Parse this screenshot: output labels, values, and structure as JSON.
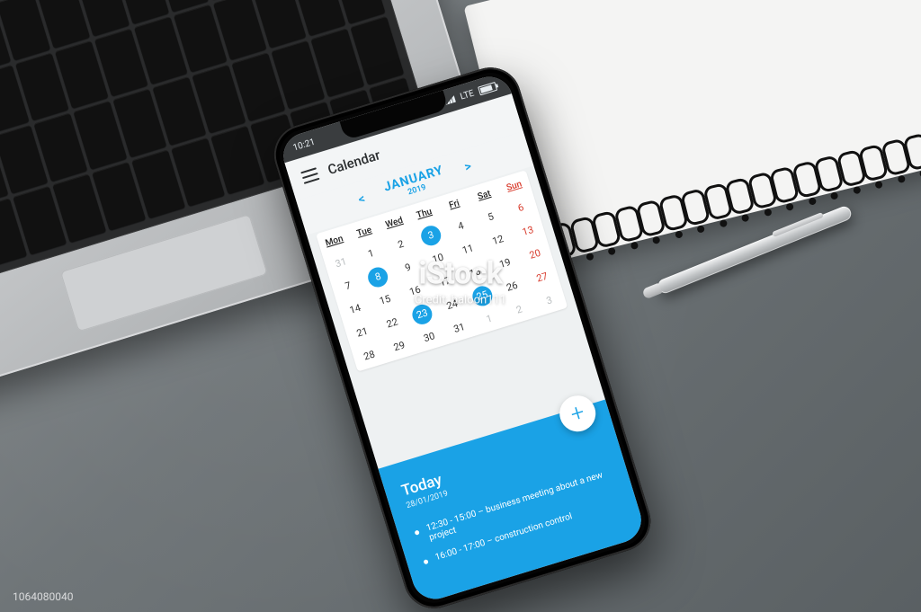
{
  "phone": {
    "status": {
      "time": "10:21",
      "network": "LTE"
    },
    "app": {
      "title": "Calendar",
      "nav": {
        "prev": "<",
        "next": ">",
        "month": "JANUARY",
        "year": "2019"
      },
      "weekdays": [
        "Mon",
        "Tue",
        "Wed",
        "Thu",
        "Fri",
        "Sat",
        "Sun"
      ],
      "highlighted_days": [
        3,
        8,
        23,
        25
      ],
      "weeks": [
        [
          {
            "n": 31,
            "dim": true
          },
          {
            "n": 1
          },
          {
            "n": 2
          },
          {
            "n": 3,
            "hl": true
          },
          {
            "n": 4
          },
          {
            "n": 5
          },
          {
            "n": 6,
            "sun": true
          }
        ],
        [
          {
            "n": 7
          },
          {
            "n": 8,
            "hl": true
          },
          {
            "n": 9
          },
          {
            "n": 10
          },
          {
            "n": 11
          },
          {
            "n": 12
          },
          {
            "n": 13,
            "sun": true
          }
        ],
        [
          {
            "n": 14
          },
          {
            "n": 15
          },
          {
            "n": 16
          },
          {
            "n": 17
          },
          {
            "n": 18
          },
          {
            "n": 19
          },
          {
            "n": 20,
            "sun": true
          }
        ],
        [
          {
            "n": 21
          },
          {
            "n": 22
          },
          {
            "n": 23,
            "hl": true
          },
          {
            "n": 24
          },
          {
            "n": 25,
            "hl": true
          },
          {
            "n": 26
          },
          {
            "n": 27,
            "sun": true
          }
        ],
        [
          {
            "n": 28
          },
          {
            "n": 29
          },
          {
            "n": 30
          },
          {
            "n": 31
          },
          {
            "n": 1,
            "dim": true
          },
          {
            "n": 2,
            "dim": true
          },
          {
            "n": 3,
            "dim": true,
            "sun": true
          }
        ]
      ],
      "fab": "+",
      "today": {
        "heading": "Today",
        "date": "28/01/2019",
        "events": [
          "12:30 - 15:00 – business meeting about a new project",
          "16:00 - 17:00 – construction control"
        ]
      }
    }
  },
  "watermark": {
    "brand": "iStock",
    "credit": "Credit: baloon111",
    "id": "1064080040"
  },
  "colors": {
    "accent": "#1aa2e6",
    "sunday": "#d83a2b"
  }
}
